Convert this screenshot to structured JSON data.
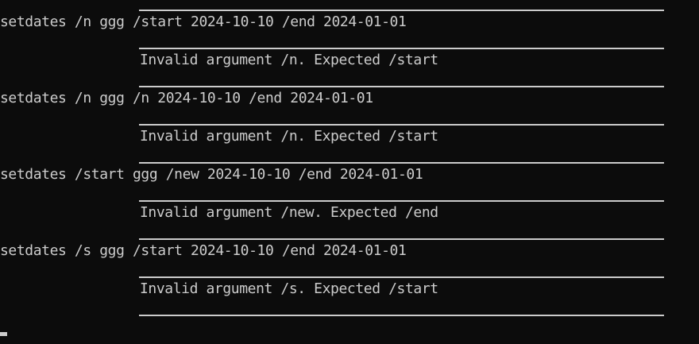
{
  "terminal": {
    "entries": [
      {
        "command": "setdates /n ggg /start 2024-10-10 /end 2024-01-01",
        "response": "Invalid argument /n. Expected /start"
      },
      {
        "command": "setdates /n ggg /n 2024-10-10 /end 2024-01-01",
        "response": "Invalid argument /n. Expected /start"
      },
      {
        "command": "setdates /start ggg /new 2024-10-10 /end 2024-01-01",
        "response": "Invalid argument /new. Expected /end"
      },
      {
        "command": "setdates /s ggg /start 2024-10-10 /end 2024-01-01",
        "response": "Invalid argument /s. Expected /start"
      }
    ]
  }
}
